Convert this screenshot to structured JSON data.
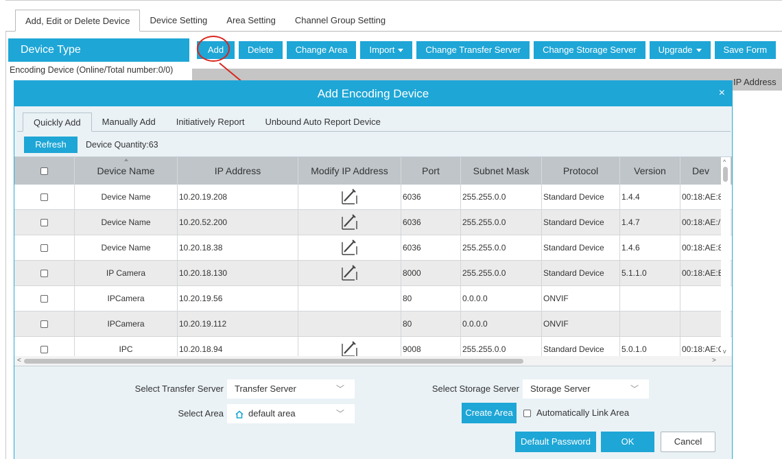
{
  "main_tabs": [
    "Add, Edit or Delete Device",
    "Device Setting",
    "Area Setting",
    "Channel Group Setting"
  ],
  "device_type": {
    "title": "Device Type",
    "encoding_summary": "Encoding Device (Online/Total number:0/0)"
  },
  "toolbar": {
    "add": "Add",
    "delete": "Delete",
    "change_area": "Change Area",
    "import": "Import",
    "change_transfer_server": "Change Transfer Server",
    "change_storage_server": "Change Storage Server",
    "upgrade": "Upgrade",
    "save_form": "Save Form"
  },
  "background_grid": {
    "ip_address_header": "IP Address"
  },
  "dialog": {
    "title": "Add  Encoding Device",
    "close_glyph": "×",
    "tabs": [
      "Quickly Add",
      "Manually Add",
      "Initiatively Report",
      "Unbound Auto Report Device"
    ],
    "refresh": "Refresh",
    "device_quantity": "Device Quantity:63",
    "columns": [
      "",
      "Device Name",
      "IP Address",
      "Modify IP Address",
      "Port",
      "Subnet Mask",
      "Protocol",
      "Version",
      "Dev"
    ],
    "rows": [
      {
        "name": "Device Name",
        "ip": "10.20.19.208",
        "edit": true,
        "port": "6036",
        "mask": "255.255.0.0",
        "protocol": "Standard Device",
        "version": "1.4.4",
        "dev": "00:18:AE:8"
      },
      {
        "name": "Device Name",
        "ip": "10.20.52.200",
        "edit": true,
        "port": "6036",
        "mask": "255.255.0.0",
        "protocol": "Standard Device",
        "version": "1.4.7",
        "dev": "00:18:AE:/"
      },
      {
        "name": "Device Name",
        "ip": "10.20.18.38",
        "edit": true,
        "port": "6036",
        "mask": "255.255.0.0",
        "protocol": "Standard Device",
        "version": "1.4.6",
        "dev": "00:18:AE:8"
      },
      {
        "name": "IP Camera",
        "ip": "10.20.18.130",
        "edit": true,
        "port": "8000",
        "mask": "255.255.0.0",
        "protocol": "Standard Device",
        "version": "5.1.1.0",
        "dev": "00:18:AE:E"
      },
      {
        "name": "IPCamera",
        "ip": "10.20.19.56",
        "edit": false,
        "port": "80",
        "mask": "0.0.0.0",
        "protocol": "ONVIF",
        "version": "",
        "dev": ""
      },
      {
        "name": "IPCamera",
        "ip": "10.20.19.112",
        "edit": false,
        "port": "80",
        "mask": "0.0.0.0",
        "protocol": "ONVIF",
        "version": "",
        "dev": ""
      },
      {
        "name": "IPC",
        "ip": "10.20.18.94",
        "edit": true,
        "port": "9008",
        "mask": "255.255.0.0",
        "protocol": "Standard Device",
        "version": "5.0.1.0",
        "dev": "00:18:AE:C"
      }
    ],
    "form": {
      "transfer_label": "Select Transfer Server",
      "transfer_value": "Transfer Server",
      "storage_label": "Select Storage Server",
      "storage_value": "Storage Server",
      "area_label": "Select Area",
      "area_value": "default area",
      "create_area": "Create Area",
      "auto_link": "Automatically Link Area",
      "default_password": "Default Password",
      "ok": "OK",
      "cancel": "Cancel"
    }
  },
  "colors": {
    "accent": "#1ea6d6",
    "highlight_circle": "#d9251d"
  }
}
